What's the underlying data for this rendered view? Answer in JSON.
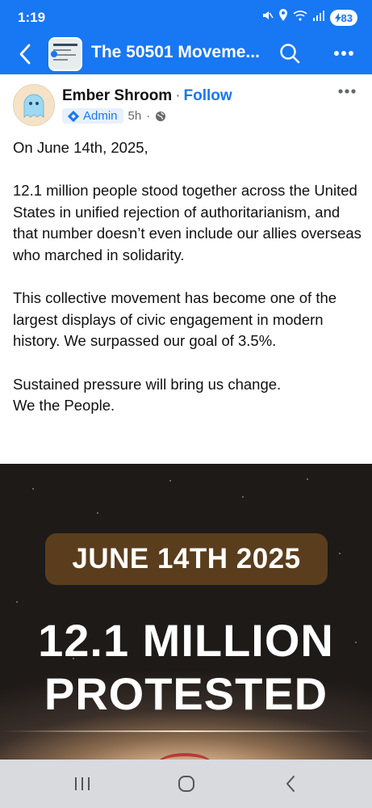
{
  "status_bar": {
    "time": "1:19",
    "battery": "83"
  },
  "header": {
    "title": "The 50501 Moveme...",
    "back_icon": "chevron-left-icon",
    "search_icon": "search-icon",
    "more_icon": "more-horizontal-icon"
  },
  "post": {
    "author": "Ember Shroom",
    "separator": "·",
    "follow_label": "Follow",
    "badge": "Admin",
    "time": "5h",
    "meta_sep": "·",
    "paragraphs": [
      "On June 14th, 2025,",
      "12.1 million people stood together across the United States in unified rejection of authoritarianism, and that number doesn’t even include our allies overseas who marched in solidarity.",
      "This collective movement has become one of the largest displays of civic engagement in modern history. We surpassed our goal of 3.5%.",
      "Sustained pressure will bring us change.\nWe the People."
    ]
  },
  "image": {
    "date_text": "JUNE 14TH 2025",
    "headline_line1": "12.1 MILLION",
    "headline_line2": "PROTESTED"
  },
  "colors": {
    "brand": "#1877f2",
    "pill": "#5a3d1c"
  }
}
